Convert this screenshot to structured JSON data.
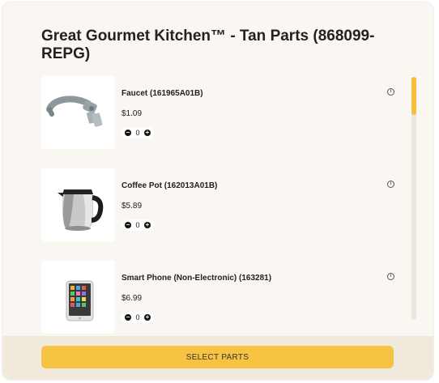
{
  "modal": {
    "title": "Great Gourmet Kitchen™ - Tan Parts (868099-REPG)"
  },
  "parts": [
    {
      "name": "Faucet (161965A01B)",
      "price": "$1.09",
      "quantity": "0",
      "icon": "faucet-image"
    },
    {
      "name": "Coffee Pot (162013A01B)",
      "price": "$5.89",
      "quantity": "0",
      "icon": "coffee-pot-image"
    },
    {
      "name": "Smart Phone (Non-Electronic) (163281)",
      "price": "$6.99",
      "quantity": "0",
      "icon": "smart-phone-image"
    }
  ],
  "footer": {
    "button_label": "SELECT PARTS"
  },
  "colors": {
    "accent": "#f7c342",
    "background": "#faf6f1",
    "footer": "#f1eadc"
  }
}
